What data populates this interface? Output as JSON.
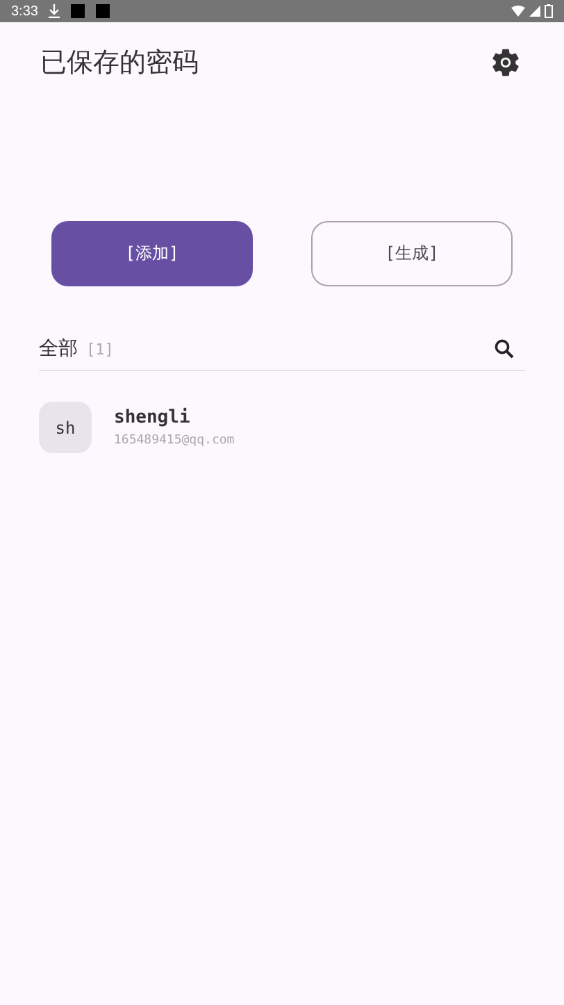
{
  "status_bar": {
    "time": "3:33"
  },
  "header": {
    "title": "已保存的密码"
  },
  "buttons": [
    {
      "label": "[添加]",
      "kind": "filled"
    },
    {
      "label": "[生成]",
      "kind": "outlined"
    }
  ],
  "filter": {
    "label": "全部",
    "count": "[1]"
  },
  "entries": [
    {
      "avatar": "sh",
      "name": "shengli",
      "account": "165489415@qq.com"
    }
  ]
}
